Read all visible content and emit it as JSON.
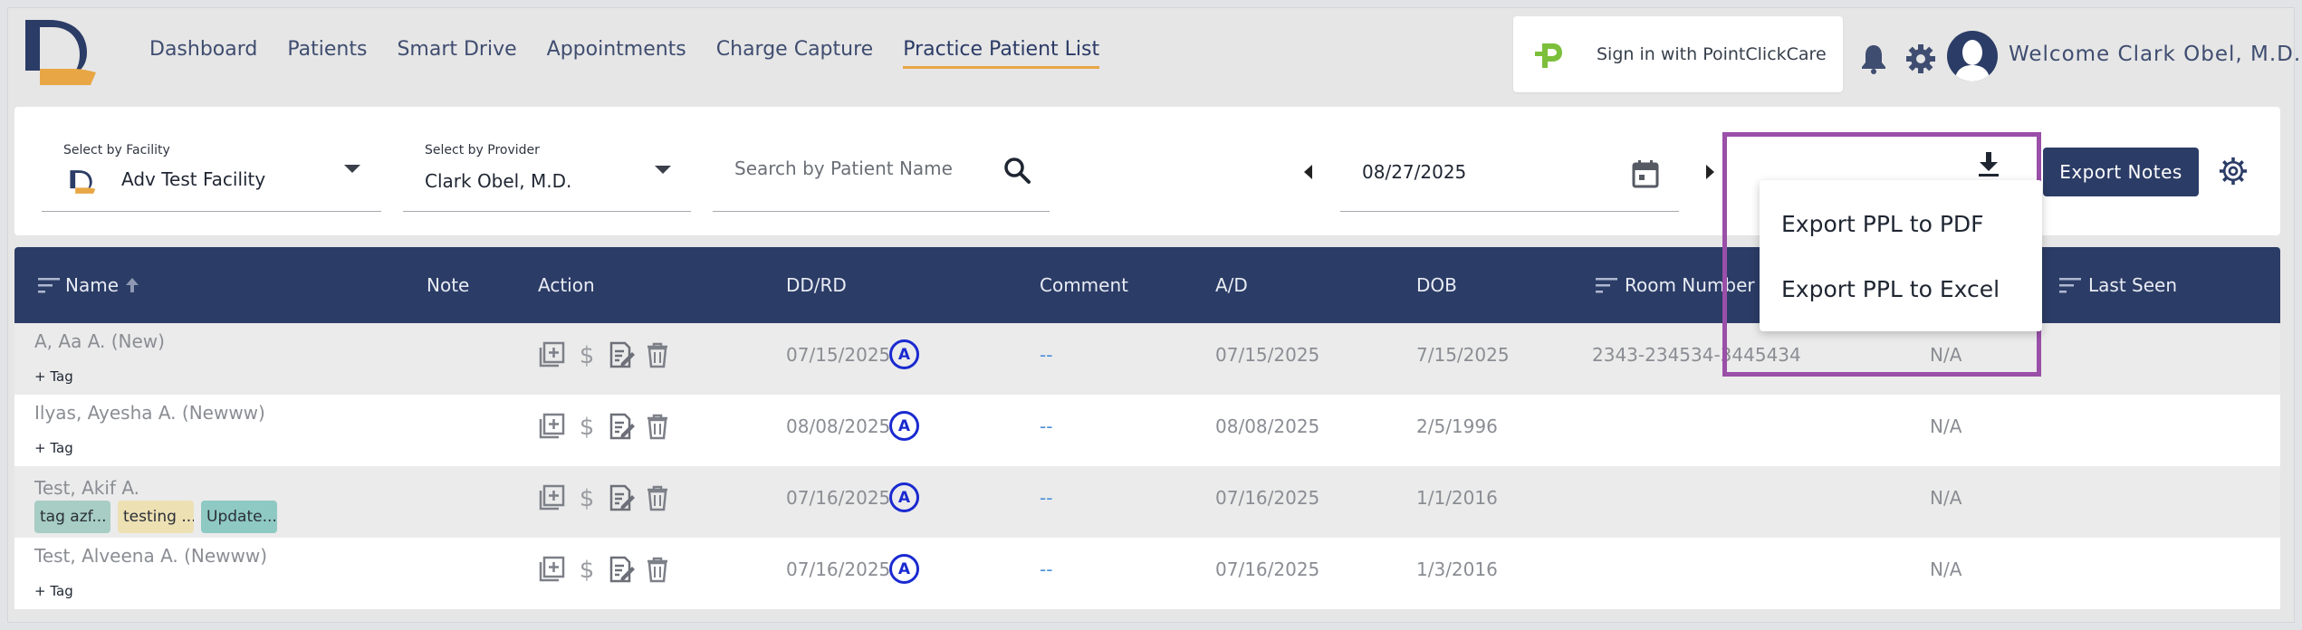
{
  "nav": {
    "items": [
      "Dashboard",
      "Patients",
      "Smart Drive",
      "Appointments",
      "Charge Capture",
      "Practice Patient List"
    ],
    "active_index": 5
  },
  "header": {
    "pcc_label": "Sign in with PointClickCare",
    "welcome": "Welcome Clark Obel, M.D."
  },
  "filters": {
    "facility_label": "Select by Facility",
    "facility_value": "Adv Test Facility",
    "provider_label": "Select by Provider",
    "provider_value": "Clark Obel, M.D.",
    "search_placeholder": "Search by Patient Name",
    "date": "08/27/2025",
    "export_notes": "Export Notes"
  },
  "export_menu": {
    "items": [
      "Export PPL to PDF",
      "Export PPL to Excel"
    ]
  },
  "table": {
    "columns": [
      "Name",
      "Note",
      "Action",
      "DD/RD",
      "Comment",
      "A/D",
      "DOB",
      "Room Number",
      "Last Seen"
    ],
    "rows": [
      {
        "name": "A, Aa A. (New)",
        "tag_add": "+ Tag",
        "tags": [],
        "dd": "07/15/2025",
        "badge": "A",
        "comment": "--",
        "ad": "07/15/2025",
        "dob": "7/15/2025",
        "room": "2343-234534-3445434",
        "status": "N/A"
      },
      {
        "name": "Ilyas, Ayesha A. (Newww)",
        "tag_add": "+ Tag",
        "tags": [],
        "dd": "08/08/2025",
        "badge": "A",
        "comment": "--",
        "ad": "08/08/2025",
        "dob": "2/5/1996",
        "room": "",
        "status": "N/A"
      },
      {
        "name": "Test, Akif A.",
        "tag_add": "",
        "tags": [
          {
            "label": "tag azf...",
            "color": "#a7cdc4"
          },
          {
            "label": "testing ...",
            "color": "#ede0b3"
          },
          {
            "label": "Update...",
            "color": "#8fc9c3"
          }
        ],
        "dd": "07/16/2025",
        "badge": "A",
        "comment": "--",
        "ad": "07/16/2025",
        "dob": "1/1/2016",
        "room": "",
        "status": "N/A"
      },
      {
        "name": "Test, Alveena A. (Newww)",
        "tag_add": "+ Tag",
        "tags": [],
        "dd": "07/16/2025",
        "badge": "A",
        "comment": "--",
        "ad": "07/16/2025",
        "dob": "1/3/2016",
        "room": "",
        "status": "N/A"
      }
    ]
  },
  "colors": {
    "navy": "#2b3c66",
    "accent_orange": "#e8a645",
    "highlight_purple": "#9a4fa8",
    "badge_blue": "#1a2ad0",
    "pcc_green": "#7cbf3a"
  },
  "icons": [
    "app-logo-icon",
    "pointclickcare-icon",
    "bell-icon",
    "gear-icon",
    "avatar-icon",
    "search-icon",
    "calendar-icon",
    "download-icon",
    "settings-icon",
    "filter-sort-icon",
    "sort-arrow-up-icon",
    "add-note-icon",
    "dollar-icon",
    "edit-document-icon",
    "trash-icon"
  ]
}
